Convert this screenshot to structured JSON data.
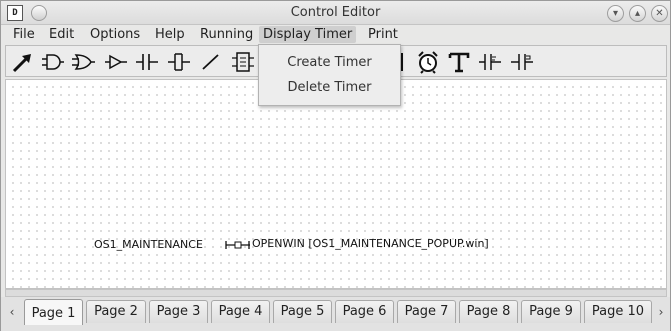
{
  "window": {
    "app_icon_text": "D",
    "title": "Control Editor",
    "min_glyph": "▾",
    "max_glyph": "▴",
    "close_glyph": "✕"
  },
  "menubar": {
    "items": [
      "File",
      "Edit",
      "Options",
      "Help",
      "Running",
      "Display Timer",
      "Print"
    ]
  },
  "toolbar": {
    "tools": [
      "arrow-icon",
      "and-gate-icon",
      "or-gate-icon",
      "buffer-gate-icon",
      "contact-icon",
      "coil-icon",
      "line-icon",
      "function-block-icon",
      "display-timer-icon",
      "alarm-clock-icon",
      "text-icon",
      "positive-contact-icon",
      "positive-coil-icon"
    ]
  },
  "dropdown": {
    "items": [
      "Create Timer",
      "Delete Timer"
    ]
  },
  "canvas": {
    "label1": "OS1_MAINTENANCE",
    "label2": "OPENWIN [OS1_MAINTENANCE_POPUP.win]"
  },
  "tabs": {
    "left_arrow": "‹",
    "right_arrow": "›",
    "items": [
      "Page 1",
      "Page 2",
      "Page 3",
      "Page 4",
      "Page 5",
      "Page 6",
      "Page 7",
      "Page 8",
      "Page 9",
      "Page 10"
    ],
    "active_index": 0
  }
}
